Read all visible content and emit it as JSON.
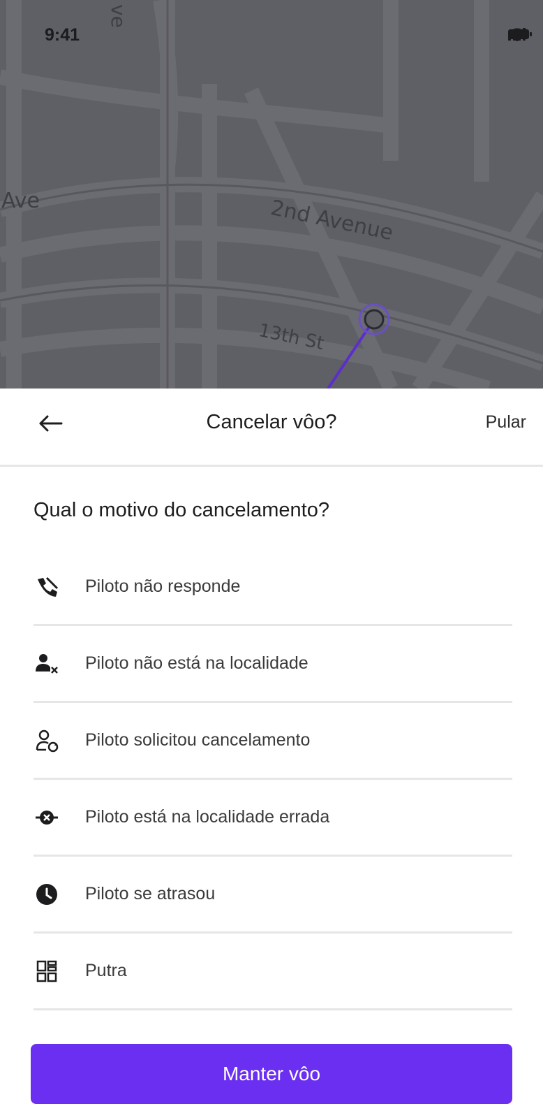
{
  "status_bar": {
    "time": "9:41",
    "icons": [
      "signal-icon",
      "wifi-icon",
      "battery-icon"
    ]
  },
  "map": {
    "street_labels": [
      "Ave",
      "2nd Avenue",
      "13th St",
      "ve"
    ],
    "route_color": "#5b2fc9"
  },
  "header": {
    "title": "Cancelar vôo?",
    "skip_label": "Pular",
    "back_icon": "arrow-left-icon"
  },
  "question": "Qual o motivo do cancelamento?",
  "reasons": [
    {
      "label": "Piloto não responde",
      "icon": "phone-missed-icon"
    },
    {
      "label": "Piloto não está na localidade",
      "icon": "user-remove-icon"
    },
    {
      "label": "Piloto solicitou cancelamento",
      "icon": "user-refresh-icon"
    },
    {
      "label": "Piloto está na localidade errada",
      "icon": "location-error-icon"
    },
    {
      "label": "Piloto se atrasou",
      "icon": "clock-icon"
    },
    {
      "label": "Putra",
      "icon": "grid-icon"
    }
  ],
  "primary_button": {
    "label": "Manter vôo",
    "color": "#6a2ff0"
  }
}
